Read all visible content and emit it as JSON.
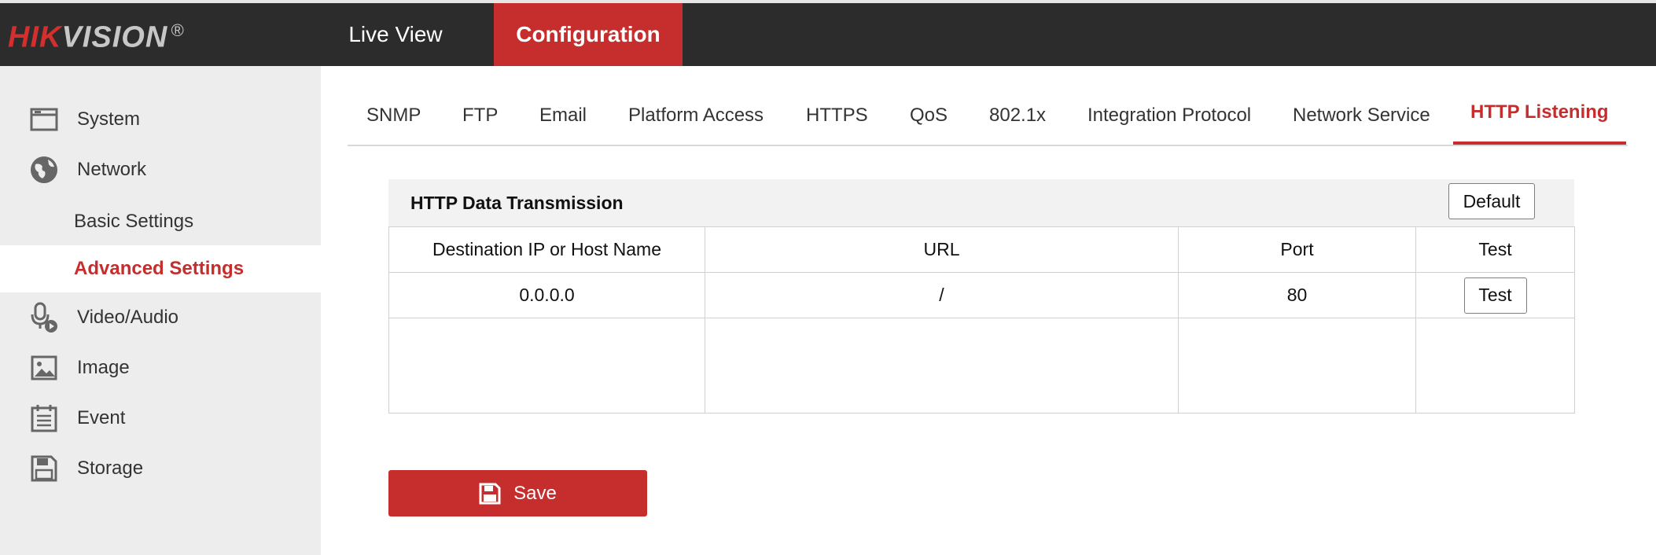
{
  "brand": {
    "logo_red": "HIK",
    "logo_rest": "VISION",
    "registered": "®"
  },
  "topnav": {
    "live_view": "Live View",
    "configuration": "Configuration"
  },
  "sidebar": {
    "items": [
      {
        "label": "System",
        "icon": "system-icon"
      },
      {
        "label": "Network",
        "icon": "globe-icon"
      },
      {
        "label": "Video/Audio",
        "icon": "microphone-icon"
      },
      {
        "label": "Image",
        "icon": "image-icon"
      },
      {
        "label": "Event",
        "icon": "calendar-icon"
      },
      {
        "label": "Storage",
        "icon": "disk-icon"
      }
    ],
    "network_sub": [
      {
        "label": "Basic Settings",
        "active": false
      },
      {
        "label": "Advanced Settings",
        "active": true
      }
    ]
  },
  "tabs": [
    {
      "label": "SNMP"
    },
    {
      "label": "FTP"
    },
    {
      "label": "Email"
    },
    {
      "label": "Platform Access"
    },
    {
      "label": "HTTPS"
    },
    {
      "label": "QoS"
    },
    {
      "label": "802.1x"
    },
    {
      "label": "Integration Protocol"
    },
    {
      "label": "Network Service"
    },
    {
      "label": "HTTP Listening",
      "active": true
    }
  ],
  "panel": {
    "title": "HTTP Data Transmission",
    "default_button": "Default",
    "columns": [
      "Destination IP or Host Name",
      "URL",
      "Port",
      "Test"
    ],
    "rows": [
      {
        "dest": "0.0.0.0",
        "url": "/",
        "port": "80",
        "test_button": "Test"
      }
    ]
  },
  "save_button": "Save",
  "colors": {
    "accent": "#c62d2d",
    "topbar": "#2c2c2c",
    "sidebar": "#ededed"
  }
}
